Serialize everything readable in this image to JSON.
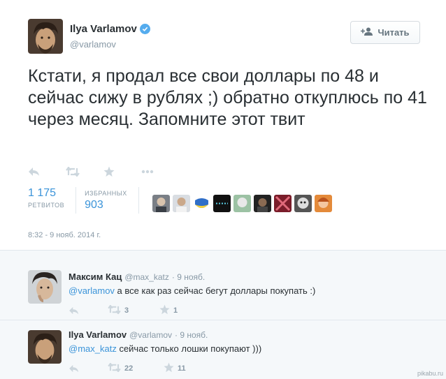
{
  "tweet": {
    "author_name": "Ilya Varlamov",
    "author_handle": "@varlamov",
    "follow_label": "Читать",
    "text": "Кстати, я продал все свои доллары по 48 и сейчас сижу в рублях ;) обратно откуплюсь по 41 через месяц. Запомните этот твит",
    "retweets_count": "1 175",
    "retweets_label": "РЕТВИТОВ",
    "favorites_label": "ИЗБРАННЫХ",
    "favorites_count": "903",
    "timestamp": "8:32 - 9 нояб. 2014 г."
  },
  "replies": [
    {
      "name": "Максим Кац",
      "handle": "@max_katz",
      "time": "· 9 нояб.",
      "mention": "@varlamov",
      "text": " а все как раз сейчас бегут доллары покупать :)",
      "retweets": "3",
      "favorites": "1"
    },
    {
      "name": "Ilya Varlamov",
      "handle": "@varlamov",
      "time": "· 9 нояб.",
      "mention": "@max_katz",
      "text": " сейчас только лошки покупают )))",
      "retweets": "22",
      "favorites": "11"
    }
  ],
  "watermark": "pikabu.ru",
  "icons": [
    "reply-icon",
    "retweet-icon",
    "favorite-icon",
    "more-icon",
    "verified-icon",
    "follow-icon"
  ],
  "colors": {
    "link": "#3b94d9",
    "muted": "#8899a6",
    "verified": "#55acee"
  }
}
